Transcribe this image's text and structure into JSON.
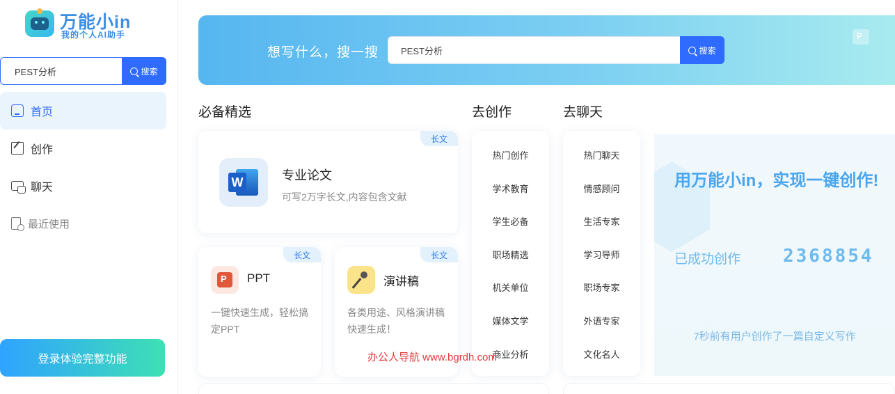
{
  "sidebar": {
    "logo_title": "万能小in",
    "logo_subtitle": "我的个人AI助手",
    "search": {
      "value": "PEST分析",
      "button_label": "搜索"
    },
    "nav": [
      {
        "label": "首页",
        "icon": "home-icon",
        "active": true
      },
      {
        "label": "创作",
        "icon": "edit-icon"
      },
      {
        "label": "聊天",
        "icon": "chat-icon"
      },
      {
        "label": "最近使用",
        "icon": "recent-icon"
      }
    ],
    "login_label": "登录体验完整功能"
  },
  "banner": {
    "prompt": "想写什么，搜一搜",
    "search_value": "PEST分析",
    "button_label": "搜索"
  },
  "sections": {
    "featured": "必备精选",
    "create": "去创作",
    "chat": "去聊天"
  },
  "featured_cards": [
    {
      "title": "专业论文",
      "desc": "可写2万字长文,内容包含文献",
      "tag": "长文",
      "icon": "word-icon"
    },
    {
      "title": "PPT",
      "desc": "一键快速生成，轻松搞定PPT",
      "tag": "长文",
      "icon": "ppt-icon"
    },
    {
      "title": "演讲稿",
      "desc": "各类用途、风格演讲稿快速生成！",
      "tag": "长文",
      "icon": "microphone-icon"
    }
  ],
  "create_list": [
    "热门创作",
    "学术教育",
    "学生必备",
    "职场精选",
    "机关单位",
    "媒体文学",
    "商业分析"
  ],
  "chat_list": [
    "热门聊天",
    "情感顾问",
    "生活专家",
    "学习导师",
    "职场专家",
    "外语专家",
    "文化名人"
  ],
  "promo": {
    "title": "用万能小in，实现一键创作!",
    "count_label": "已成功创作",
    "count": "2368854",
    "note": "7秒前有用户创作了一篇自定义写作"
  },
  "watermark": "办公人导航 www.bgrdh.com",
  "colors": {
    "accent": "#2f6bff",
    "tag_bg": "#e3f1fd",
    "promo_text": "#4aa6ee"
  }
}
